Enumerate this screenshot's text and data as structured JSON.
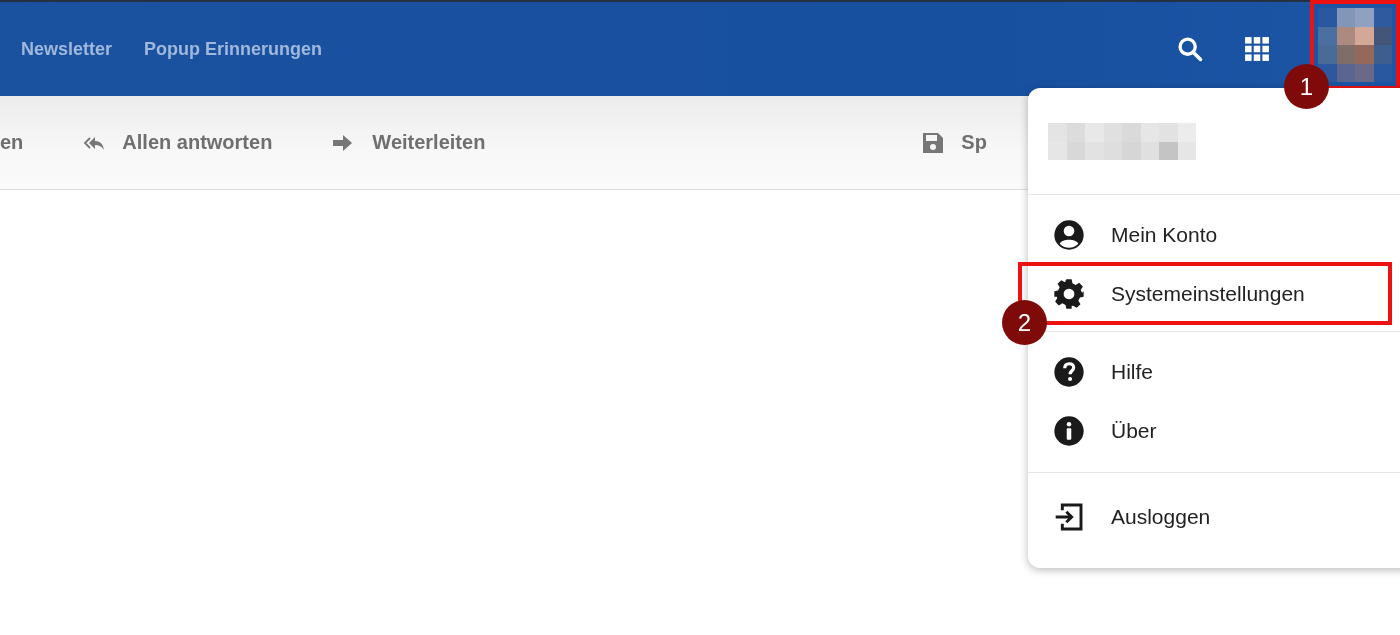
{
  "top_nav": {
    "links": [
      {
        "label": "Newsletter"
      },
      {
        "label": "Popup Erinnerungen"
      }
    ]
  },
  "toolbar": {
    "actions": [
      {
        "kind": "partial",
        "label": "en"
      },
      {
        "kind": "reply-all",
        "label": "Allen antworten"
      },
      {
        "kind": "forward",
        "label": "Weiterleiten"
      },
      {
        "kind": "save",
        "label": "Sp"
      }
    ]
  },
  "avatar": {
    "step": "1"
  },
  "user_menu": {
    "sections": [
      {
        "items": [
          {
            "kind": "account",
            "label": "Mein Konto"
          },
          {
            "kind": "settings",
            "label": "Systemeinstellungen",
            "step": "2"
          }
        ]
      },
      {
        "items": [
          {
            "kind": "help",
            "label": "Hilfe"
          },
          {
            "kind": "info",
            "label": "Über"
          }
        ]
      },
      {
        "items": [
          {
            "kind": "logout",
            "label": "Ausloggen"
          }
        ]
      }
    ]
  }
}
